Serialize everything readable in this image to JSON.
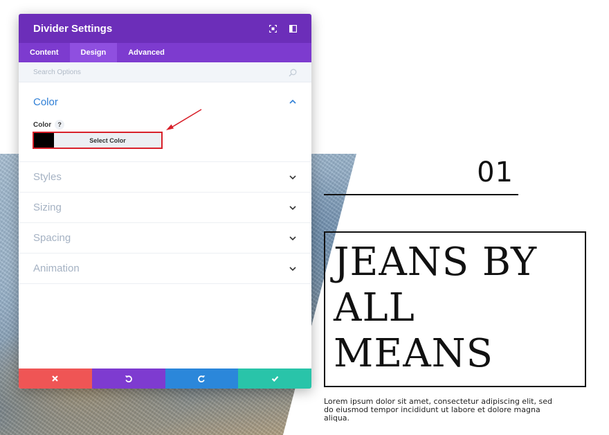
{
  "modal": {
    "title": "Divider Settings",
    "header_icons": [
      "fullscreen-icon",
      "sidebar-layout-icon"
    ],
    "tabs": [
      {
        "label": "Content",
        "active": false
      },
      {
        "label": "Design",
        "active": true
      },
      {
        "label": "Advanced",
        "active": false
      }
    ],
    "search": {
      "placeholder": "Search Options",
      "value": ""
    },
    "color_section": {
      "title": "Color",
      "expanded": true,
      "field_label": "Color",
      "help_label": "?",
      "swatch_color": "#000000",
      "select_button_label": "Select Color"
    },
    "sections": [
      {
        "label": "Styles"
      },
      {
        "label": "Sizing"
      },
      {
        "label": "Spacing"
      },
      {
        "label": "Animation"
      }
    ],
    "footer": {
      "buttons": [
        {
          "name": "discard",
          "icon": "close-icon",
          "color": "#ef5555"
        },
        {
          "name": "undo",
          "icon": "undo-icon",
          "color": "#7e3bd0"
        },
        {
          "name": "redo",
          "icon": "redo-icon",
          "color": "#2b87da"
        },
        {
          "name": "save",
          "icon": "check-icon",
          "color": "#29c4a9"
        }
      ]
    },
    "colors": {
      "header": "#6c2eb9",
      "tabs": "#7d3bcf",
      "active_tab": "#8f4fe0",
      "accent": "#2f7fd6",
      "highlight": "#d8202a"
    }
  },
  "page": {
    "number": "01",
    "headline": "JEANS BY\nALL\nMEANS",
    "body": "Lorem ipsum dolor sit amet, consectetur adipiscing elit, sed do eiusmod tempor incididunt ut labore et dolore magna aliqua."
  }
}
